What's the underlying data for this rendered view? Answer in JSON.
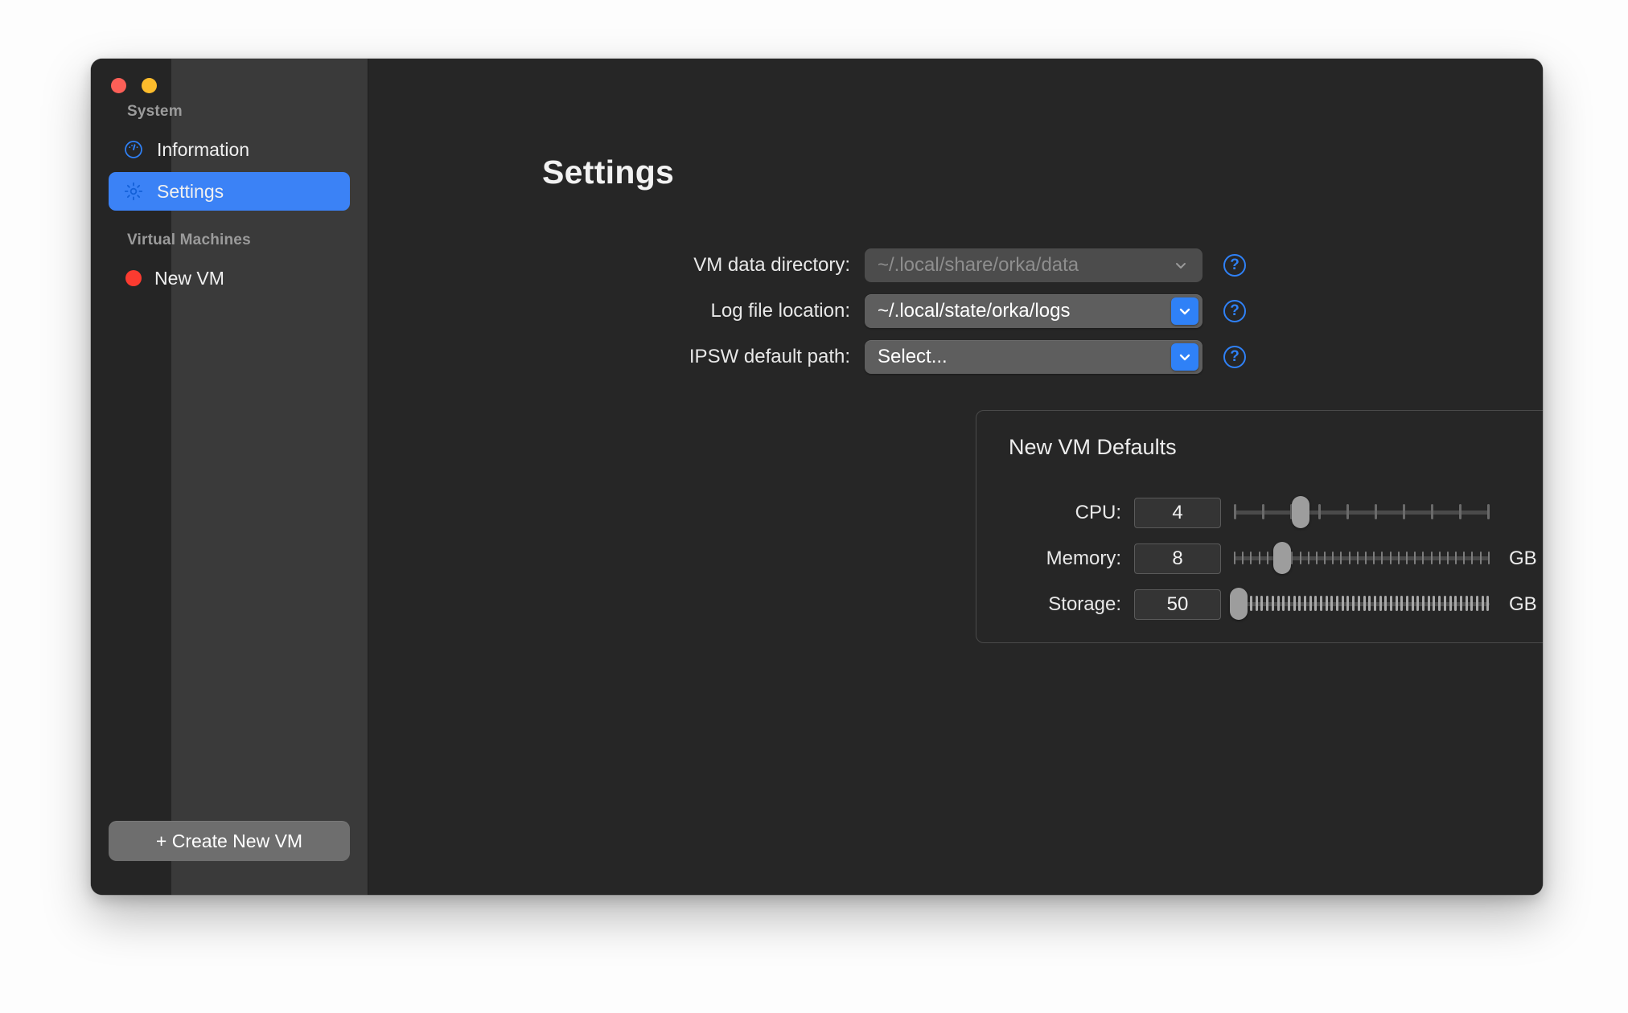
{
  "window": {
    "traffic_lights": [
      {
        "name": "close",
        "color": "#fc5f57"
      },
      {
        "name": "minimize",
        "color": "#fdbc2c"
      }
    ]
  },
  "sidebar": {
    "sections": [
      {
        "header": "System",
        "items": [
          {
            "label": "Information",
            "icon": "gauge-icon",
            "selected": false
          },
          {
            "label": "Settings",
            "icon": "gear-icon",
            "selected": true
          }
        ]
      },
      {
        "header": "Virtual Machines",
        "items": [
          {
            "label": "New VM",
            "icon": "status-dot-red",
            "status_color": "#fb3b30",
            "selected": false
          }
        ]
      }
    ],
    "create_vm_button": "+ Create New VM"
  },
  "main": {
    "title": "Settings",
    "fields": [
      {
        "label": "VM data directory:",
        "value": "~/.local/share/orka/data",
        "disabled": true,
        "help": "?"
      },
      {
        "label": "Log file location:",
        "value": "~/.local/state/orka/logs",
        "disabled": false,
        "help": "?"
      },
      {
        "label": "IPSW default path:",
        "value": "Select...",
        "disabled": false,
        "help": "?"
      }
    ],
    "group": {
      "title": "New VM Defaults",
      "sliders": [
        {
          "label": "CPU:",
          "value": "4",
          "unit": "",
          "tick_count": 10,
          "tick_style": "normal",
          "thumb_percent": 26
        },
        {
          "label": "Memory:",
          "value": "8",
          "unit": "GB",
          "tick_count": 32,
          "tick_style": "dense",
          "thumb_percent": 19
        },
        {
          "label": "Storage:",
          "value": "50",
          "unit": "GB",
          "tick_count": 48,
          "tick_style": "superdense",
          "thumb_percent": 2
        }
      ]
    }
  },
  "colors": {
    "accent": "#3b82f6",
    "link_blue": "#2f81f7",
    "sidebar_bg": "#3a3a3a",
    "main_bg": "#262626",
    "vm_status_red": "#fb3b30"
  }
}
